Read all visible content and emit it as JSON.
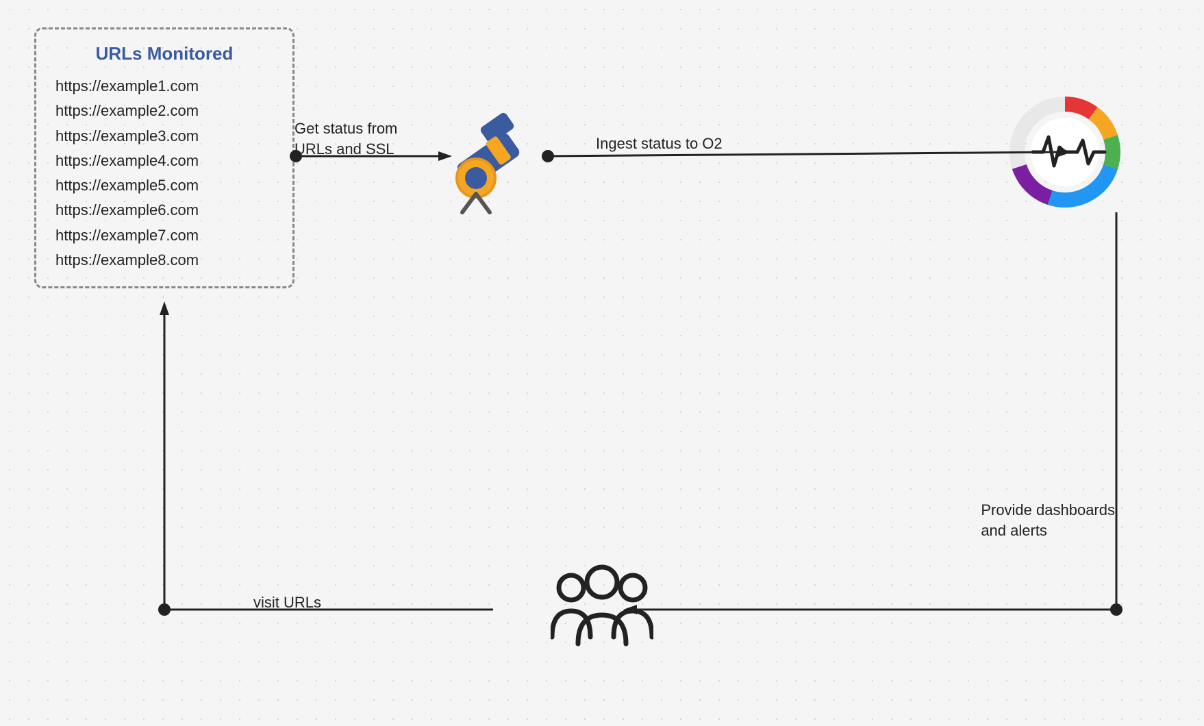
{
  "urls_box": {
    "title": "URLs Monitored",
    "urls": [
      "https://example1.com",
      "https://example2.com",
      "https://example3.com",
      "https://example4.com",
      "https://example5.com",
      "https://example6.com",
      "https://example7.com",
      "https://example8.com"
    ]
  },
  "labels": {
    "get_status": "Get status from\nURLs and SSL",
    "ingest_status": "Ingest status to O2",
    "provide_dashboards": "Provide dashboards\nand alerts",
    "visit_urls": "visit URLs"
  },
  "colors": {
    "arrow": "#222222",
    "dot": "#222222",
    "title": "#3a5ba0",
    "box_border": "#888888"
  }
}
